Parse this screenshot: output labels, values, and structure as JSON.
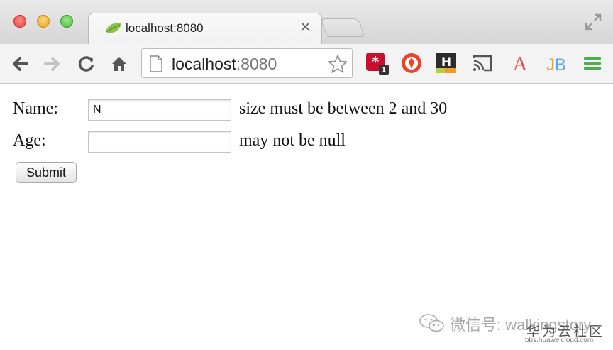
{
  "browser": {
    "tab": {
      "title": "localhost:8080",
      "close_glyph": "×",
      "favicon": "spring-leaf-icon"
    },
    "address_bar": {
      "host": "localhost",
      "port": ":8080"
    },
    "extensions": [
      {
        "name": "lastpass-icon",
        "badge": "1",
        "color": "#c8102e"
      },
      {
        "name": "shield-ext-icon",
        "color": "#e8452c"
      },
      {
        "name": "hacker-news-ext-icon",
        "color": "#2b2b2b"
      },
      {
        "name": "cast-icon",
        "color": "#555555"
      },
      {
        "name": "font-a-icon",
        "letter": "A",
        "color": "#d9534f"
      },
      {
        "name": "jetbrains-icon",
        "letter": "JB",
        "color": "#f0a030"
      },
      {
        "name": "menu-icon",
        "color": "#4caf50"
      }
    ]
  },
  "form": {
    "name_label": "Name:",
    "name_value": "N",
    "name_error": "size must be between 2 and 30",
    "age_label": "Age:",
    "age_value": "",
    "age_error": "may not be null",
    "submit_label": "Submit"
  },
  "watermark": {
    "wechat_text": "微信号: walkingstory",
    "brand": "华为云社区",
    "url": "bbs.huaweicloud.com"
  }
}
